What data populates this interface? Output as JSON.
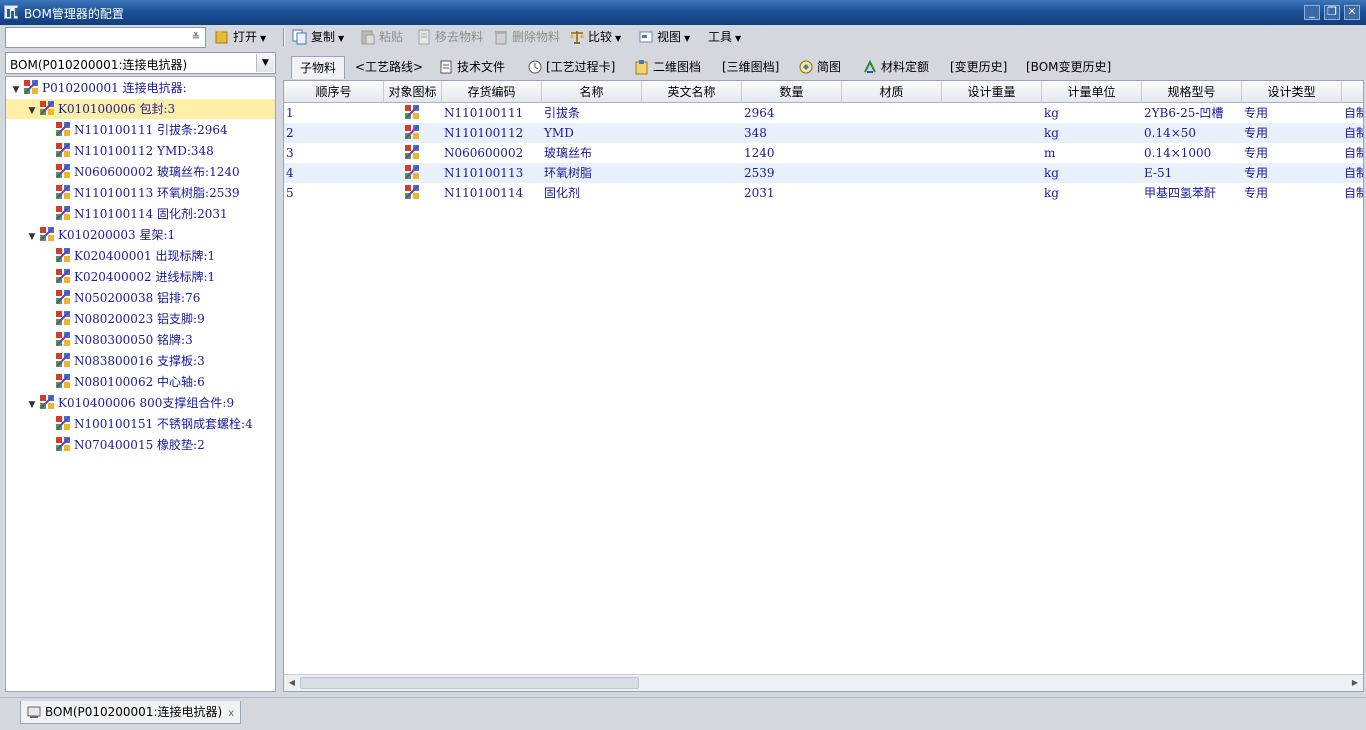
{
  "window": {
    "title": "BOM管理器的配置",
    "minimize": "_",
    "restore": "❐",
    "close": "✕"
  },
  "toolbar_left": {
    "search_value": "",
    "open_label": "打开"
  },
  "toolbar": {
    "copy": "复制",
    "paste": "粘贴",
    "remove": "移去物料",
    "delete": "删除物料",
    "compare": "比较",
    "view": "视图",
    "tools": "工具"
  },
  "tree": {
    "selector": "BOM(P010200001:连接电抗器)",
    "nodes": [
      {
        "label": "P010200001 连接电抗器:",
        "level": 0,
        "expanded": true
      },
      {
        "label": "K010100006 包封:3",
        "level": 1,
        "expanded": true,
        "selected": true
      },
      {
        "label": "N110100111 引拔条:2964",
        "level": 2
      },
      {
        "label": "N110100112 YMD:348",
        "level": 2
      },
      {
        "label": "N060600002 玻璃丝布:1240",
        "level": 2
      },
      {
        "label": "N110100113 环氧树脂:2539",
        "level": 2
      },
      {
        "label": "N110100114 固化剂:2031",
        "level": 2
      },
      {
        "label": "K010200003 星架:1",
        "level": 1,
        "expanded": true
      },
      {
        "label": "K020400001 出现标牌:1",
        "level": 2
      },
      {
        "label": "K020400002 进线标牌:1",
        "level": 2
      },
      {
        "label": "N050200038 铝排:76",
        "level": 2
      },
      {
        "label": "N080200023 铝支脚:9",
        "level": 2
      },
      {
        "label": "N080300050 铭牌:3",
        "level": 2
      },
      {
        "label": "N083800016 支撑板:3",
        "level": 2
      },
      {
        "label": "N080100062 中心轴:6",
        "level": 2
      },
      {
        "label": "K010400006 800支撑组合件:9",
        "level": 1,
        "expanded": true
      },
      {
        "label": "N100100151 不锈钢成套螺栓:4",
        "level": 2
      },
      {
        "label": "N070400015 橡胶垫:2",
        "level": 2
      }
    ]
  },
  "tabs": [
    {
      "label": "子物料",
      "active": true
    },
    {
      "label": "<工艺路线>"
    },
    {
      "label": "技术文件",
      "icon": "document-icon"
    },
    {
      "label": "[工艺过程卡]",
      "icon": "process-card-icon"
    },
    {
      "label": "二维图档",
      "icon": "drawing-2d-icon"
    },
    {
      "label": "[三维图档]"
    },
    {
      "label": "简图",
      "icon": "sketch-icon"
    },
    {
      "label": "材料定额",
      "icon": "material-quota-icon"
    },
    {
      "label": "[变更历史]"
    },
    {
      "label": "[BOM变更历史]"
    }
  ],
  "grid": {
    "columns": [
      "顺序号",
      "对象图标",
      "存货编码",
      "名称",
      "英文名称",
      "数量",
      "材质",
      "设计重量",
      "计量单位",
      "规格型号",
      "设计类型",
      ""
    ],
    "rows": [
      [
        "1",
        "",
        "N110100111",
        "引拔条",
        "",
        "2964",
        "",
        "",
        "kg",
        "2YB6-25-凹槽",
        "专用",
        "自制"
      ],
      [
        "2",
        "",
        "N110100112",
        "YMD",
        "",
        "348",
        "",
        "",
        "kg",
        "0.14×50",
        "专用",
        "自制"
      ],
      [
        "3",
        "",
        "N060600002",
        "玻璃丝布",
        "",
        "1240",
        "",
        "",
        "m",
        "0.14×1000",
        "专用",
        "自制"
      ],
      [
        "4",
        "",
        "N110100113",
        "环氧树脂",
        "",
        "2539",
        "",
        "",
        "kg",
        "E-51",
        "专用",
        "自制"
      ],
      [
        "5",
        "",
        "N110100114",
        "固化剂",
        "",
        "2031",
        "",
        "",
        "kg",
        "甲基四氢苯酐",
        "专用",
        "自制"
      ]
    ]
  },
  "bottom_tab": {
    "label": "BOM(P010200001:连接电抗器)",
    "close": "x"
  },
  "colors": {
    "title_bar": "#1b4f96",
    "link_text": "#1a1aa0",
    "selected_row": "#fdf0a6",
    "alt_row": "#e8f0fa"
  }
}
